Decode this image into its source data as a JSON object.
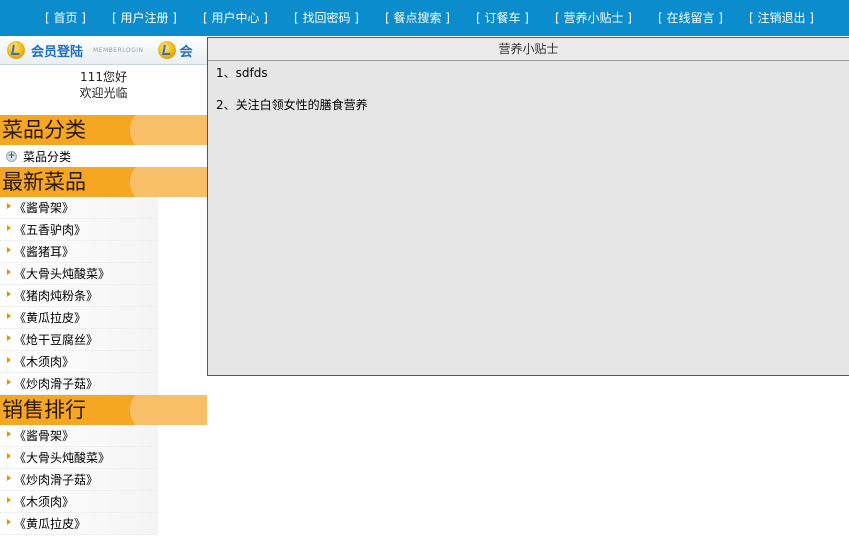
{
  "nav": {
    "items": [
      "[ 首页 ]",
      "[ 用户注册 ]",
      "[ 用户中心 ]",
      "[ 找回密码 ]",
      "[ 餐点搜索 ]",
      "[ 订餐车 ]",
      "[ 营养小贴士 ]",
      "[ 在线留言 ]",
      "[ 注销退出 ]"
    ]
  },
  "member": {
    "title": "会员登陆",
    "subtitle": "MEMBERLOGIN",
    "title_repeat": "会",
    "greeting": "111您好",
    "welcome": "欢迎光临"
  },
  "categories": {
    "heading": "菜品分类",
    "items": [
      "菜品分类"
    ]
  },
  "newest": {
    "heading": "最新菜品",
    "items": [
      "《酱骨架》",
      "《五香驴肉》",
      "《酱猪耳》",
      "《大骨头炖酸菜》",
      "《猪肉炖粉条》",
      "《黄瓜拉皮》",
      "《炝干豆腐丝》",
      "《木须肉》",
      "《炒肉滑子菇》"
    ]
  },
  "ranking": {
    "heading": "销售排行",
    "items": [
      "《酱骨架》",
      "《大骨头炖酸菜》",
      "《炒肉滑子菇》",
      "《木须肉》",
      "《黄瓜拉皮》"
    ]
  },
  "main": {
    "title": "营养小贴士",
    "tips": [
      "1、sdfds",
      "2、关注白领女性的膳食营养"
    ]
  },
  "colors": {
    "nav_bg": "#0a8ccd",
    "section_bg": "#f5a623",
    "panel_bg": "#e6e6e6"
  }
}
